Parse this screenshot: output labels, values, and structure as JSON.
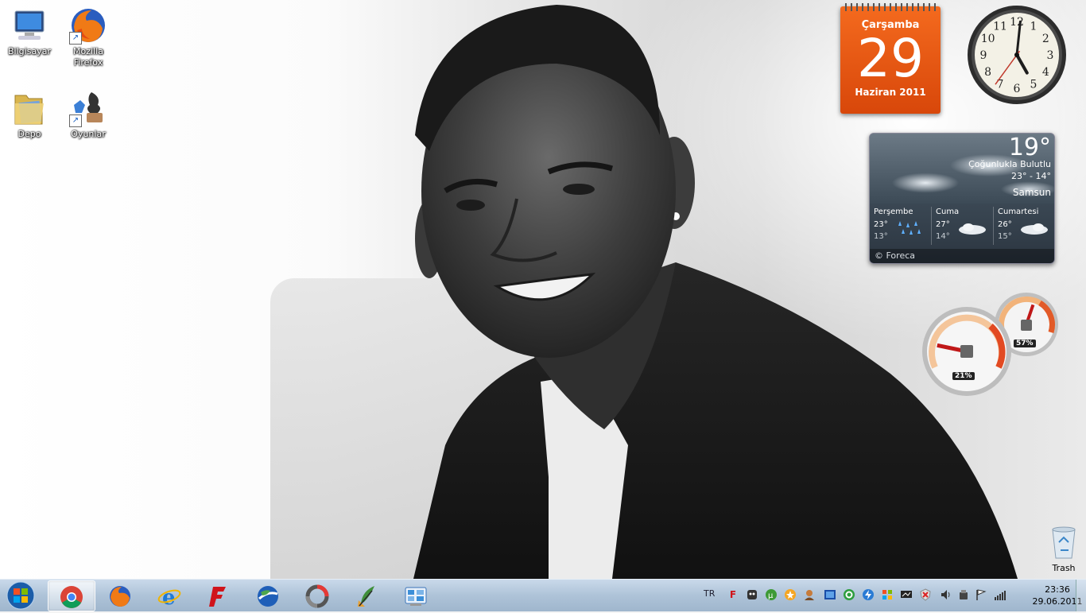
{
  "desktop": {
    "icons": [
      {
        "label": "Bilgisayar",
        "icon": "computer-icon"
      },
      {
        "label": "Mozilla Firefox",
        "icon": "firefox-icon"
      },
      {
        "label": "Depo",
        "icon": "folder-icon"
      },
      {
        "label": "Oyunlar",
        "icon": "games-icon"
      }
    ],
    "trash": {
      "label": "Trash",
      "icon": "recycle-bin-icon"
    }
  },
  "calendar": {
    "day_name": "Çarşamba",
    "day": "29",
    "month_year": "Haziran 2011",
    "color": "#e8570f"
  },
  "clock": {
    "numerals": [
      "12",
      "1",
      "2",
      "3",
      "4",
      "5",
      "6",
      "7",
      "8",
      "9",
      "10",
      "11"
    ],
    "hour": 5,
    "minute": 1,
    "second": 36
  },
  "weather": {
    "temp": "19°",
    "condition": "Çoğunlukla Bulutlu",
    "range": "23° - 14°",
    "city": "Samsun",
    "forecast": [
      {
        "day": "Perşembe",
        "high": "23°",
        "low": "13°",
        "icon": "rain-icon"
      },
      {
        "day": "Cuma",
        "high": "27°",
        "low": "14°",
        "icon": "cloud-icon"
      },
      {
        "day": "Cumartesi",
        "high": "26°",
        "low": "15°",
        "icon": "cloud-icon"
      }
    ],
    "credit": "© Foreca"
  },
  "meters": {
    "cpu": "21%",
    "memory": "57%",
    "cpu_value": 0.21,
    "memory_value": 0.57
  },
  "taskbar": {
    "apps": [
      {
        "name": "chrome",
        "icon": "chrome-icon",
        "active": true
      },
      {
        "name": "firefox",
        "icon": "firefox-icon",
        "active": false
      },
      {
        "name": "internet-explorer",
        "icon": "ie-icon",
        "active": false
      },
      {
        "name": "flashget",
        "icon": "flashget-icon",
        "active": false
      },
      {
        "name": "google-earth",
        "icon": "google-earth-icon",
        "active": false
      },
      {
        "name": "picasa",
        "icon": "picasa-icon",
        "active": false
      },
      {
        "name": "writer",
        "icon": "quill-icon",
        "active": false
      },
      {
        "name": "control-panel",
        "icon": "control-panel-icon",
        "active": false
      }
    ],
    "language": "TR",
    "time": "23:36",
    "date": "29.06.2011"
  }
}
